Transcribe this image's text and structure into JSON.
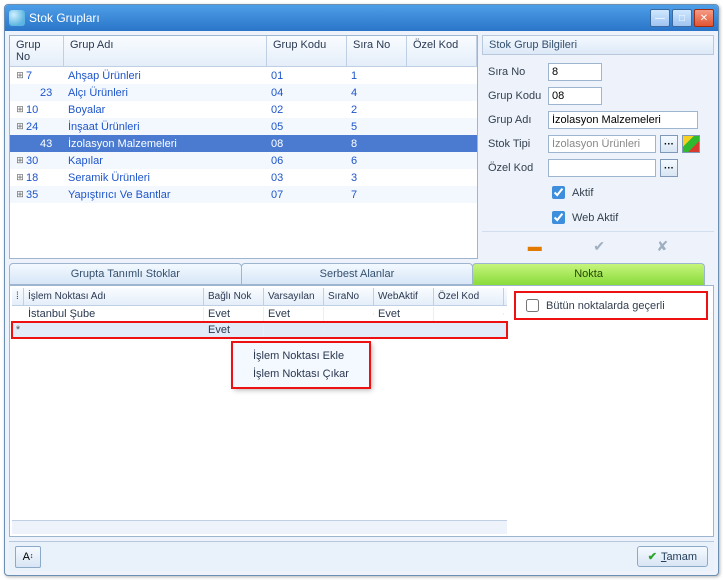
{
  "window": {
    "title": "Stok Grupları"
  },
  "tree": {
    "columns": {
      "no": "Grup No",
      "ad": "Grup Adı",
      "kod": "Grup Kodu",
      "sira": "Sıra No",
      "ozel": "Özel Kod"
    },
    "rows": [
      {
        "no": "7",
        "ad": "Ahşap Ürünleri",
        "kod": "01",
        "sira": "1",
        "exp": true,
        "child": false,
        "alt": false,
        "sel": false
      },
      {
        "no": "23",
        "ad": "Alçı Ürünleri",
        "kod": "04",
        "sira": "4",
        "exp": false,
        "child": true,
        "alt": true,
        "sel": false
      },
      {
        "no": "10",
        "ad": "Boyalar",
        "kod": "02",
        "sira": "2",
        "exp": true,
        "child": false,
        "alt": false,
        "sel": false
      },
      {
        "no": "24",
        "ad": "İnşaat Ürünleri",
        "kod": "05",
        "sira": "5",
        "exp": true,
        "child": false,
        "alt": true,
        "sel": false
      },
      {
        "no": "43",
        "ad": "İzolasyon Malzemeleri",
        "kod": "08",
        "sira": "8",
        "exp": false,
        "child": true,
        "alt": false,
        "sel": true
      },
      {
        "no": "30",
        "ad": "Kapılar",
        "kod": "06",
        "sira": "6",
        "exp": true,
        "child": false,
        "alt": true,
        "sel": false
      },
      {
        "no": "18",
        "ad": "Seramik Ürünleri",
        "kod": "03",
        "sira": "3",
        "exp": true,
        "child": false,
        "alt": false,
        "sel": false
      },
      {
        "no": "35",
        "ad": "Yapıştırıcı Ve Bantlar",
        "kod": "07",
        "sira": "7",
        "exp": true,
        "child": false,
        "alt": true,
        "sel": false
      }
    ]
  },
  "side": {
    "title": "Stok Grup Bilgileri",
    "labels": {
      "sira": "Sıra No",
      "kod": "Grup Kodu",
      "ad": "Grup Adı",
      "tip": "Stok Tipi",
      "ozel": "Özel Kod",
      "aktif": "Aktif",
      "webaktif": "Web Aktif"
    },
    "values": {
      "sira": "8",
      "kod": "08",
      "ad": "İzolasyon Malzemeleri",
      "tip": "İzolasyon Ürünleri",
      "ozel": ""
    }
  },
  "tabs": {
    "t1": "Grupta Tanımlı Stoklar",
    "t2": "Serbest Alanlar",
    "t3": "Nokta"
  },
  "grid": {
    "columns": {
      "ad": "İşlem Noktası Adı",
      "bn": "Bağlı Nok",
      "var": "Varsayılan",
      "sn": "SıraNo",
      "wa": "WebAktif",
      "ok": "Özel Kod"
    },
    "rows": [
      {
        "ad": "İstanbul Şube",
        "bn": "Evet",
        "var": "Evet",
        "sn": "",
        "wa": "Evet",
        "ok": "",
        "star": ""
      },
      {
        "ad": "",
        "bn": "Evet",
        "var": "",
        "sn": "",
        "wa": "",
        "ok": "",
        "star": "*",
        "sel": true,
        "red": true
      }
    ]
  },
  "context": {
    "add": "İşlem Noktası Ekle",
    "remove": "İşlem Noktası Çıkar"
  },
  "checkbox_all": "Bütün noktalarda geçerli",
  "ok_button": "Tamam"
}
